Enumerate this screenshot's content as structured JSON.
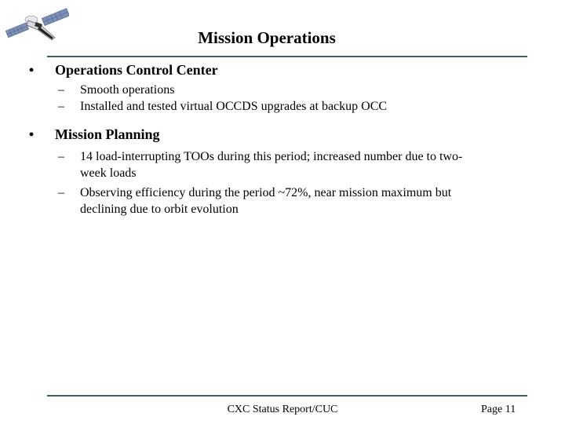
{
  "slide": {
    "title": "Mission Operations",
    "logo_icon": "satellite-icon",
    "rule_color": "#3f5f66",
    "sections": [
      {
        "heading": "Operations Control Center",
        "items": [
          "Smooth operations",
          "Installed and tested virtual OCCDS upgrades at backup OCC"
        ]
      },
      {
        "heading": "Mission Planning",
        "items": [
          "14 load-interrupting TOOs during this period; increased number due to two-week loads",
          "Observing efficiency during the period ~72%, near mission maximum but declining due to orbit evolution"
        ]
      }
    ],
    "bullet_glyph": "•",
    "dash_glyph": "–"
  },
  "footer": {
    "center_text": "CXC Status Report/CUC",
    "page_label": "Page 11"
  }
}
